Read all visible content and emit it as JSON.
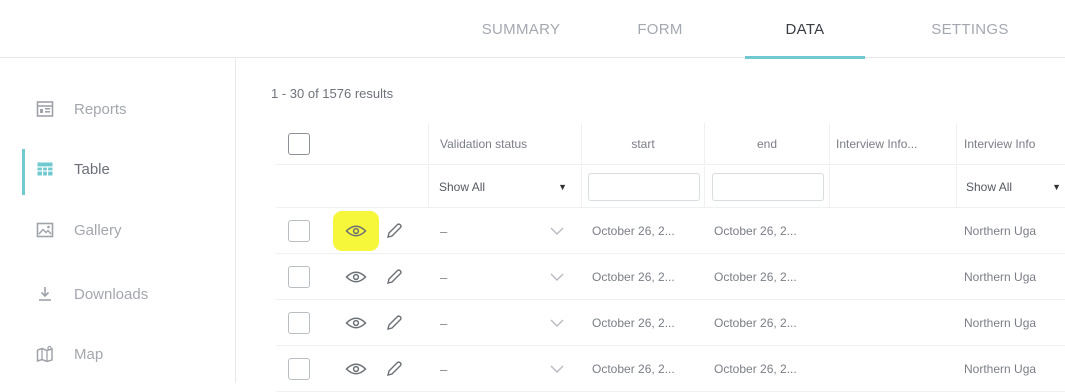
{
  "tabs": [
    {
      "label": "SUMMARY"
    },
    {
      "label": "FORM"
    },
    {
      "label": "DATA"
    },
    {
      "label": "SETTINGS"
    }
  ],
  "sidebar": {
    "items": [
      {
        "label": "Reports",
        "icon": "reports-icon"
      },
      {
        "label": "Table",
        "icon": "table-icon"
      },
      {
        "label": "Gallery",
        "icon": "gallery-icon"
      },
      {
        "label": "Downloads",
        "icon": "downloads-icon"
      },
      {
        "label": "Map",
        "icon": "map-icon"
      }
    ],
    "active": "Table"
  },
  "results_text": "1 - 30 of 1576 results",
  "table": {
    "headers": {
      "validation": "Validation status",
      "start": "start",
      "end": "end",
      "interview1": "Interview Info...",
      "interview2": "Interview Info"
    },
    "filters": {
      "validation": "Show All",
      "interview2": "Show All"
    },
    "rows": [
      {
        "validation": "–",
        "start": "October 26, 2...",
        "end": "October 26, 2...",
        "interview1": "",
        "interview2": "Northern Uga"
      },
      {
        "validation": "–",
        "start": "October 26, 2...",
        "end": "October 26, 2...",
        "interview1": "",
        "interview2": "Northern Uga"
      },
      {
        "validation": "–",
        "start": "October 26, 2...",
        "end": "October 26, 2...",
        "interview1": "",
        "interview2": "Northern Uga"
      },
      {
        "validation": "–",
        "start": "October 26, 2...",
        "end": "October 26, 2...",
        "interview1": "",
        "interview2": "Northern Uga"
      }
    ]
  },
  "colors": {
    "accent": "#6fc9cf",
    "highlight": "#f6f63a"
  }
}
